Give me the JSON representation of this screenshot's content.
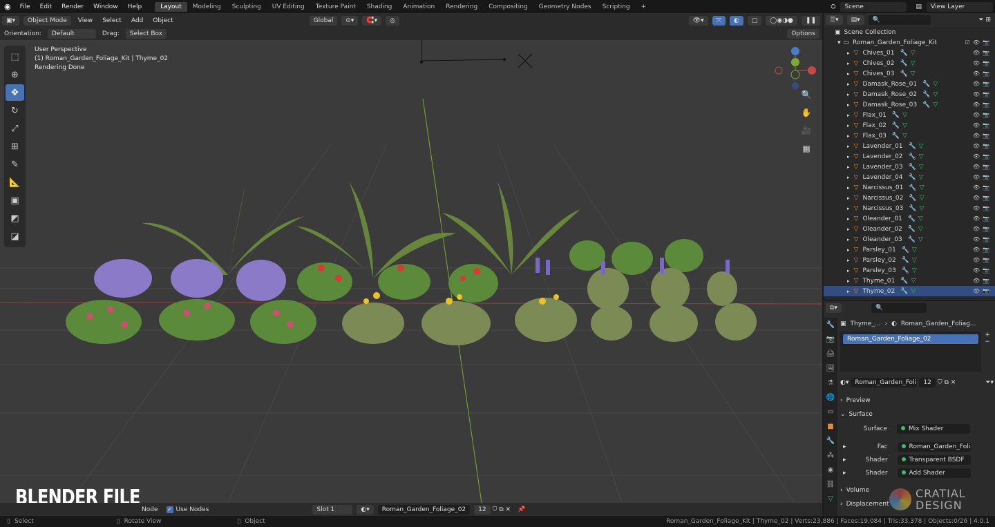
{
  "menu": [
    "File",
    "Edit",
    "Render",
    "Window",
    "Help"
  ],
  "workspaces": [
    "Layout",
    "Modeling",
    "Sculpting",
    "UV Editing",
    "Texture Paint",
    "Shading",
    "Animation",
    "Rendering",
    "Compositing",
    "Geometry Nodes",
    "Scripting"
  ],
  "active_workspace": "Layout",
  "scene": "Scene",
  "view_layer": "View Layer",
  "header": {
    "mode": "Object Mode",
    "view": "View",
    "select": "Select",
    "add": "Add",
    "object": "Object",
    "transform": "Global",
    "options": "Options"
  },
  "toolbar_row": {
    "orientation_label": "Orientation:",
    "orientation": "Default",
    "drag_label": "Drag:",
    "drag": "Select Box"
  },
  "viewport": {
    "perspective": "User Perspective",
    "object_line": "(1) Roman_Garden_Foliage_Kit | Thyme_02",
    "status": "Rendering Done"
  },
  "outliner": {
    "root": "Scene Collection",
    "collection": "Roman_Garden_Foliage_Kit",
    "items": [
      "Chives_01",
      "Chives_02",
      "Chives_03",
      "Damask_Rose_01",
      "Damask_Rose_02",
      "Damask_Rose_03",
      "Flax_01",
      "Flax_02",
      "Flax_03",
      "Lavender_01",
      "Lavender_02",
      "Lavender_03",
      "Lavender_04",
      "Narcissus_01",
      "Narcissus_02",
      "Narcissus_03",
      "Oleander_01",
      "Oleander_02",
      "Oleander_03",
      "Parsley_01",
      "Parsley_02",
      "Parsley_03",
      "Thyme_01",
      "Thyme_02"
    ]
  },
  "properties": {
    "breadcrumb_object": "Thyme_...",
    "breadcrumb_material": "Roman_Garden_Foliag...",
    "slot_material": "Roman_Garden_Foliage_02",
    "material_field": "Roman_Garden_Foli...",
    "users": "12",
    "preview": "Preview",
    "surface_section": "Surface",
    "surface_label": "Surface",
    "surface_value": "Mix Shader",
    "fac_label": "Fac",
    "fac_value": "Roman_Garden_Foliag...",
    "shader1_label": "Shader",
    "shader1_value": "Transparent BSDF",
    "shader2_label": "Shader",
    "shader2_value": "Add Shader",
    "volume": "Volume",
    "displacement": "Displacement"
  },
  "footer": {
    "node": "Node",
    "use_nodes": "Use Nodes",
    "slot": "Slot 1",
    "material": "Roman_Garden_Foliage_02",
    "users": "12"
  },
  "overlay": {
    "blender_file": "BLENDER FILE",
    "logo_top": "CRATIAL",
    "logo_bottom": "DESIGN"
  },
  "statusbar": {
    "select": "Select",
    "rotate": "Rotate View",
    "object": "Object",
    "info": "Roman_Garden_Foliage_Kit | Thyme_02 | Verts:23,886 | Faces:19,084 | Tris:33,378 | Objects:0/26 | 4.0.1"
  },
  "colors": {
    "accent": "#4772b3",
    "viewport": "#3b3b3b",
    "x_axis": "#c64848",
    "y_axis": "#7fa832"
  }
}
